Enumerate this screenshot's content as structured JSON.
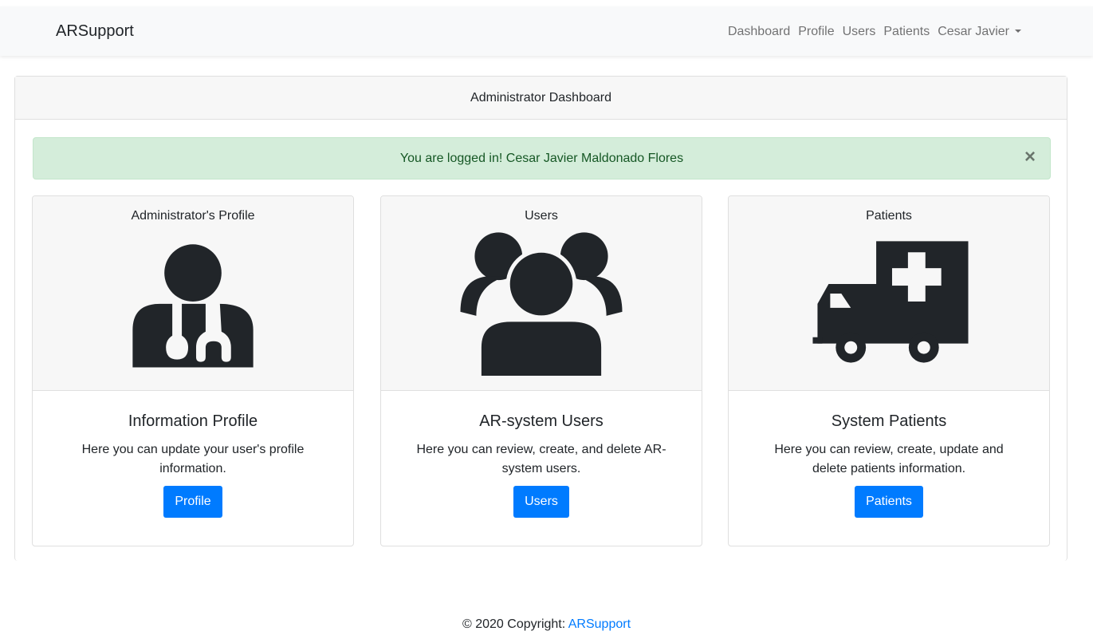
{
  "navbar": {
    "brand": "ARSupport",
    "links": [
      "Dashboard",
      "Profile",
      "Users",
      "Patients"
    ],
    "user_menu": "Cesar Javier"
  },
  "panel": {
    "title": "Administrator Dashboard",
    "alert": {
      "text": "You are logged in! Cesar Javier Maldonado Flores",
      "close": "×"
    },
    "cards": [
      {
        "caption": "Administrator's Profile",
        "icon": "doctor-icon",
        "title": "Information Profile",
        "text": "Here you can update your user's profile information.",
        "button": "Profile"
      },
      {
        "caption": "Users",
        "icon": "users-group-icon",
        "title": "AR-system Users",
        "text": "Here you can review, create, and delete AR-system users.",
        "button": "Users"
      },
      {
        "caption": "Patients",
        "icon": "ambulance-icon",
        "title": "System Patients",
        "text": "Here you can review, create, update and delete patients information.",
        "button": "Patients"
      }
    ]
  },
  "footer": {
    "text": "© 2020 Copyright: ",
    "link": "ARSupport"
  },
  "colors": {
    "primary": "#007bff",
    "alert_bg": "#d4edda",
    "alert_text": "#155724",
    "icon": "#212529"
  }
}
